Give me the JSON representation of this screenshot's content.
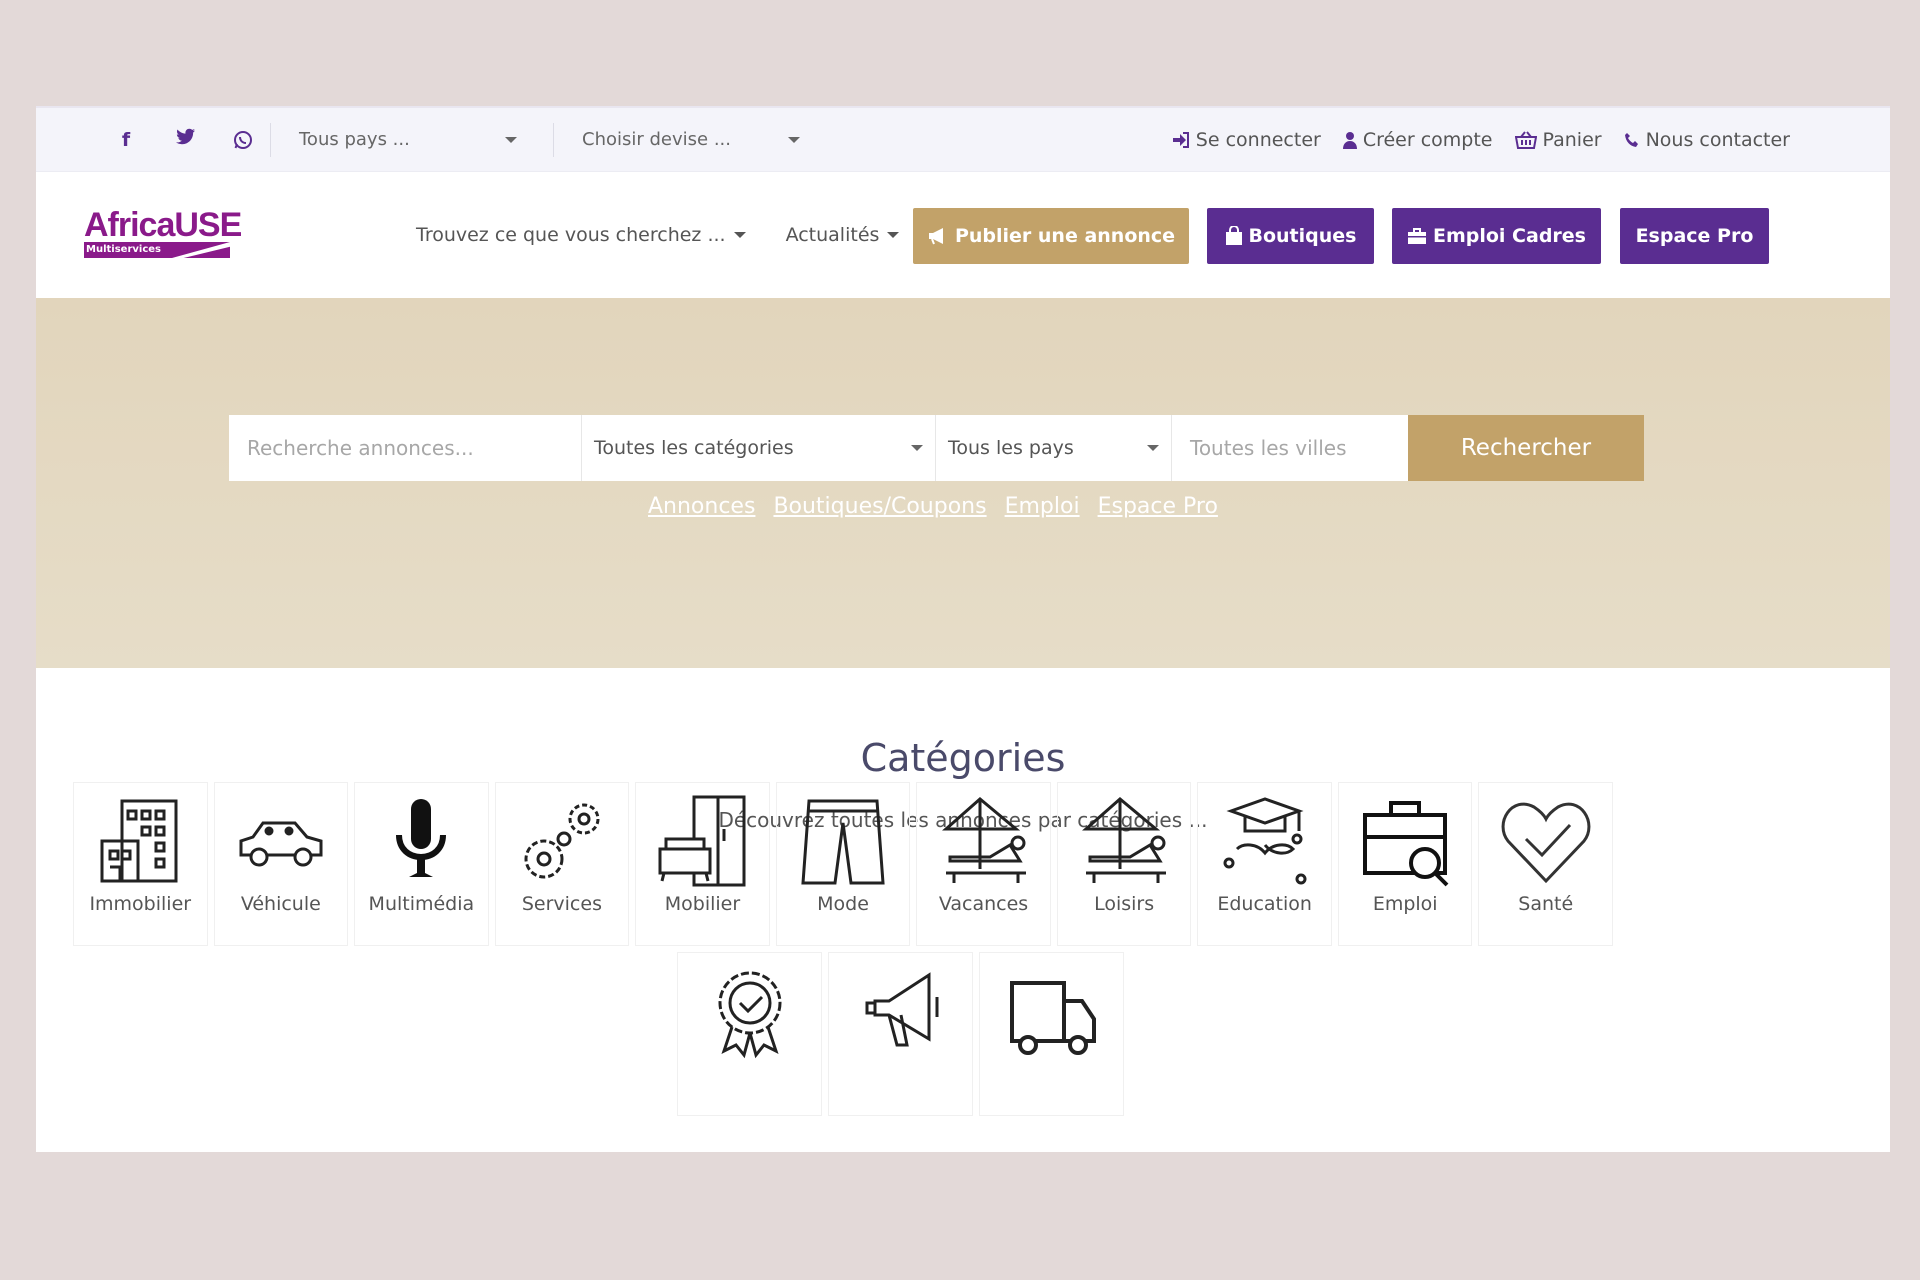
{
  "topbar": {
    "social": [
      "facebook-icon",
      "twitter-icon",
      "whatsapp-icon"
    ],
    "country_select": "Tous pays ...",
    "currency_select": "Choisir devise ...",
    "links": [
      {
        "icon": "sign-in-icon",
        "label": "Se connecter"
      },
      {
        "icon": "user-icon",
        "label": "Créer compte"
      },
      {
        "icon": "basket-icon",
        "label": "Panier"
      },
      {
        "icon": "phone-icon",
        "label": "Nous contacter"
      }
    ]
  },
  "header": {
    "logo_text": "AfricaUSE",
    "logo_sub": "Multiservices",
    "nav": [
      "Trouvez ce que vous cherchez ...",
      "Actualités"
    ],
    "buttons": {
      "publish": "Publier une annonce",
      "shops": "Boutiques",
      "jobs": "Emploi Cadres",
      "pro": "Espace Pro"
    }
  },
  "search": {
    "placeholder": "Recherche annonces...",
    "category": "Toutes les catégories",
    "country": "Tous les pays",
    "city_placeholder": "Toutes les villes",
    "button": "Rechercher",
    "quick_links": [
      "Annonces",
      "Boutiques/Coupons",
      "Emploi",
      "Espace Pro"
    ]
  },
  "categories": {
    "title": "Catégories",
    "subtitle": "Découvrez toutes les annonces par catégories ...",
    "items": [
      "Immobilier",
      "Véhicule",
      "Multimédia",
      "Services",
      "Mobilier",
      "Mode",
      "Vacances",
      "Loisirs",
      "Education",
      "Emploi",
      "Santé"
    ],
    "icons_row2": [
      "certificate-icon",
      "megaphone-icon",
      "truck-icon"
    ]
  },
  "colors": {
    "purple": "#5a2d91",
    "gold": "#c2a269",
    "hero": "#e4d9c2"
  }
}
